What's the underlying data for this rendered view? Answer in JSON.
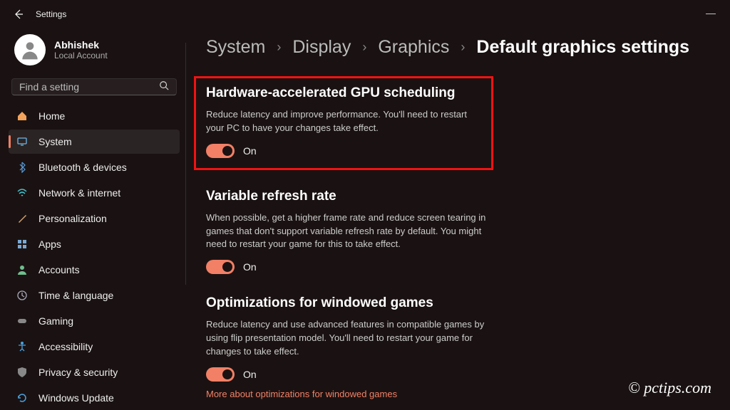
{
  "window": {
    "title": "Settings"
  },
  "user": {
    "name": "Abhishek",
    "sub": "Local Account"
  },
  "search": {
    "placeholder": "Find a setting"
  },
  "nav": {
    "home": "Home",
    "system": "System",
    "bluetooth": "Bluetooth & devices",
    "network": "Network & internet",
    "personalization": "Personalization",
    "apps": "Apps",
    "accounts": "Accounts",
    "time": "Time & language",
    "gaming": "Gaming",
    "accessibility": "Accessibility",
    "privacy": "Privacy & security",
    "update": "Windows Update"
  },
  "breadcrumb": {
    "c1": "System",
    "c2": "Display",
    "c3": "Graphics",
    "c4": "Default graphics settings"
  },
  "sections": {
    "gpu": {
      "title": "Hardware-accelerated GPU scheduling",
      "desc": "Reduce latency and improve performance. You'll need to restart your PC to have your changes take effect.",
      "toggle": "On"
    },
    "vrr": {
      "title": "Variable refresh rate",
      "desc": "When possible, get a higher frame rate and reduce screen tearing in games that don't support variable refresh rate by default. You might need to restart your game for this to take effect.",
      "toggle": "On"
    },
    "windowed": {
      "title": "Optimizations for windowed games",
      "desc": "Reduce latency and use advanced features in compatible games by using flip presentation model. You'll need to restart your game for changes to take effect.",
      "toggle": "On",
      "link": "More about optimizations for windowed games"
    }
  },
  "watermark": "© pctips.com"
}
